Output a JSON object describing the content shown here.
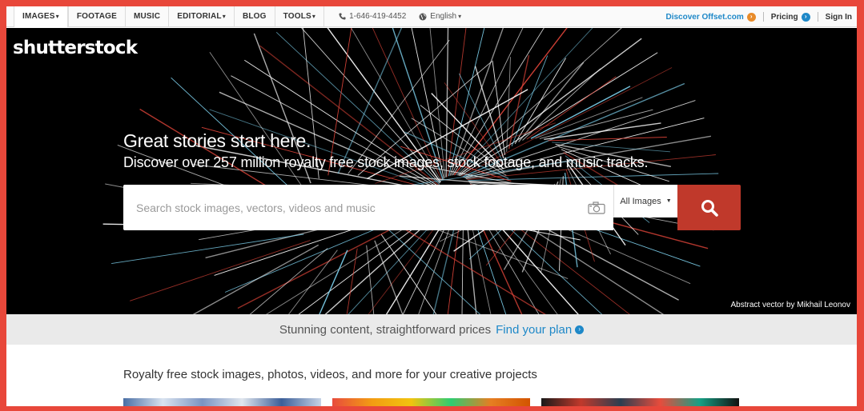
{
  "nav": {
    "tabs": [
      {
        "label": "IMAGES",
        "caret": "▾"
      },
      {
        "label": "FOOTAGE"
      },
      {
        "label": "MUSIC"
      },
      {
        "label": "EDITORIAL",
        "caret": "▾"
      },
      {
        "label": "BLOG"
      },
      {
        "label": "TOOLS",
        "caret": "▾"
      }
    ],
    "phone": "1-646-419-4452",
    "language": "English",
    "language_caret": "▾",
    "offset_link": "Discover Offset.com",
    "pricing": "Pricing",
    "signin": "Sign In"
  },
  "hero": {
    "logo": "shutterstock",
    "headline": "Great stories start here.",
    "subline": "Discover over 257 million royalty free stock images, stock footage, and music tracks.",
    "search_placeholder": "Search stock images, vectors, videos and music",
    "search_value": "",
    "filter_label": "All Images",
    "credit": "Abstract vector by Mikhail Leonov"
  },
  "promo": {
    "text": "Stunning content, straightforward prices",
    "link": "Find your plan"
  },
  "tagline": "Royalty free stock images, photos, videos, and more for your creative projects",
  "icons": {
    "phone": "phone-icon",
    "globe": "globe-icon",
    "camera": "camera-icon",
    "search": "search-icon",
    "arrow": "arrow-right-icon"
  },
  "colors": {
    "accent_red": "#c0392b",
    "link_blue": "#1e88c8",
    "offset_orange": "#e88b2a",
    "frame_red": "#e8473a"
  }
}
